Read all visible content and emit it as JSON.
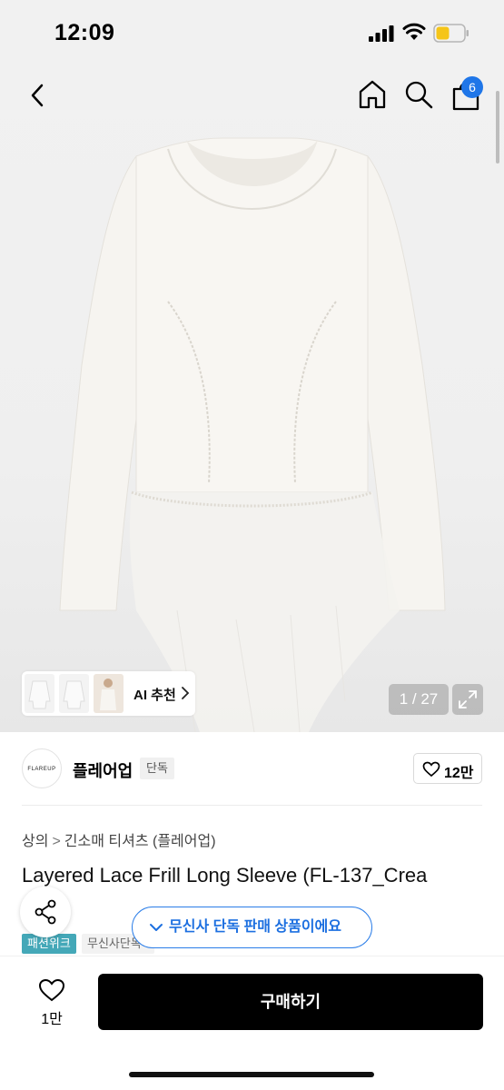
{
  "status_bar": {
    "time": "12:09"
  },
  "header": {
    "cart_count": "6"
  },
  "gallery": {
    "ai_label": "AI 추천",
    "page_counter": "1 / 27"
  },
  "brand": {
    "logo_text": "FLAREUP",
    "name": "플레어업",
    "exclusive_badge": "단독",
    "like_count": "12만"
  },
  "breadcrumb": {
    "category": "상의",
    "subcategory": "긴소매 티셔츠 (플레어업)"
  },
  "product": {
    "title": "Layered Lace Frill Long Sleeve (FL-137_Crea"
  },
  "tags": {
    "fashion_week": "패션위크",
    "musinsa_exclusive": "무신사단독"
  },
  "toast": {
    "message": "무신사 단독 판매 상품이에요"
  },
  "bottom_bar": {
    "heart_count": "1만",
    "buy_label": "구매하기"
  },
  "colors": {
    "accent_blue": "#2a7de8",
    "tag_teal": "#44a8b8",
    "buy_button": "#000000"
  }
}
